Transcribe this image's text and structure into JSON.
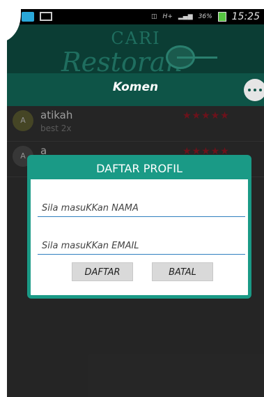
{
  "status_bar": {
    "network": "H+",
    "battery_pct": "36%",
    "time": "15:25"
  },
  "header": {
    "logo_top": "CARI",
    "logo_bottom": "Restoran",
    "title": "Komen"
  },
  "comments": [
    {
      "avatar": "A",
      "name": "atikah",
      "text": "best 2x",
      "stars": "★★★★★"
    },
    {
      "avatar": "A",
      "name": "a",
      "text": "",
      "stars": "★★★★★"
    }
  ],
  "dialog": {
    "title": "DAFTAR PROFIL",
    "name_placeholder": "Sila masuKKan NAMA",
    "email_placeholder": "Sila masuKKan EMAIL",
    "register_label": "DAFTAR",
    "cancel_label": "BATAL"
  },
  "colors": {
    "header_dark": "#0b3d34",
    "title_bar": "#0e5447",
    "dialog_accent": "#1a9a86",
    "stars": "#a61d2a"
  }
}
